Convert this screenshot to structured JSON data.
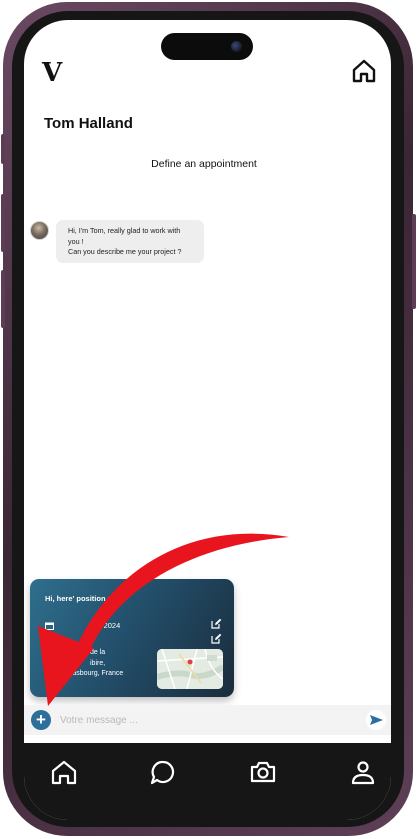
{
  "header": {
    "logo_text": "V",
    "home_icon": "home-icon"
  },
  "chat": {
    "contact_name": "Tom Halland",
    "define_appointment": "Define an appointment",
    "message": {
      "line1": "Hi, I'm Tom, really glad to work with",
      "line2": "you !",
      "line3": "Can you describe me your project ?"
    }
  },
  "proposition_card": {
    "title": "Hi, here'        position :",
    "date": "02 / 2024",
    "location_line1": "de la",
    "location_line2": "ibire,",
    "location_line3": "rasbourg, France",
    "calendar_icon": "calendar-icon",
    "edit_icon": "edit-icon"
  },
  "composer": {
    "placeholder": "Votre message ...",
    "add_icon": "plus-icon",
    "send_icon": "send-icon"
  },
  "tabbar": {
    "items": [
      "home-icon",
      "chat-icon",
      "camera-icon",
      "profile-icon"
    ]
  },
  "colors": {
    "accent": "#2d6f9b",
    "arrow": "#e8141e",
    "tabbar": "#161616",
    "card_start": "#2f6f8d",
    "card_end": "#1a2c3c"
  }
}
